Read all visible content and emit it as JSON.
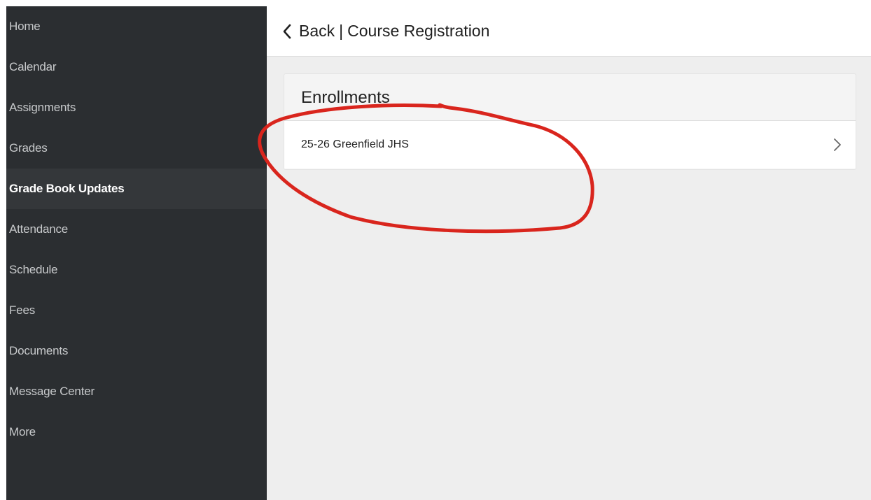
{
  "sidebar": {
    "items": [
      {
        "label": "Home"
      },
      {
        "label": "Calendar"
      },
      {
        "label": "Assignments"
      },
      {
        "label": "Grades"
      },
      {
        "label": "Grade Book Updates",
        "active": true
      },
      {
        "label": "Attendance"
      },
      {
        "label": "Schedule"
      },
      {
        "label": "Fees"
      },
      {
        "label": "Documents"
      },
      {
        "label": "Message Center"
      },
      {
        "label": "More"
      }
    ]
  },
  "header": {
    "back_label": "Back",
    "separator": "|",
    "title": "Course Registration",
    "back_icon": "chevron-left-icon"
  },
  "enrollments": {
    "heading": "Enrollments",
    "items": [
      {
        "label": "25-26 Greenfield JHS",
        "icon": "chevron-right-icon"
      }
    ]
  },
  "colors": {
    "sidebar_bg": "#2b2e31",
    "sidebar_active_bg": "#34373a",
    "content_bg": "#eeeeee",
    "annotation": "#d9251d"
  }
}
